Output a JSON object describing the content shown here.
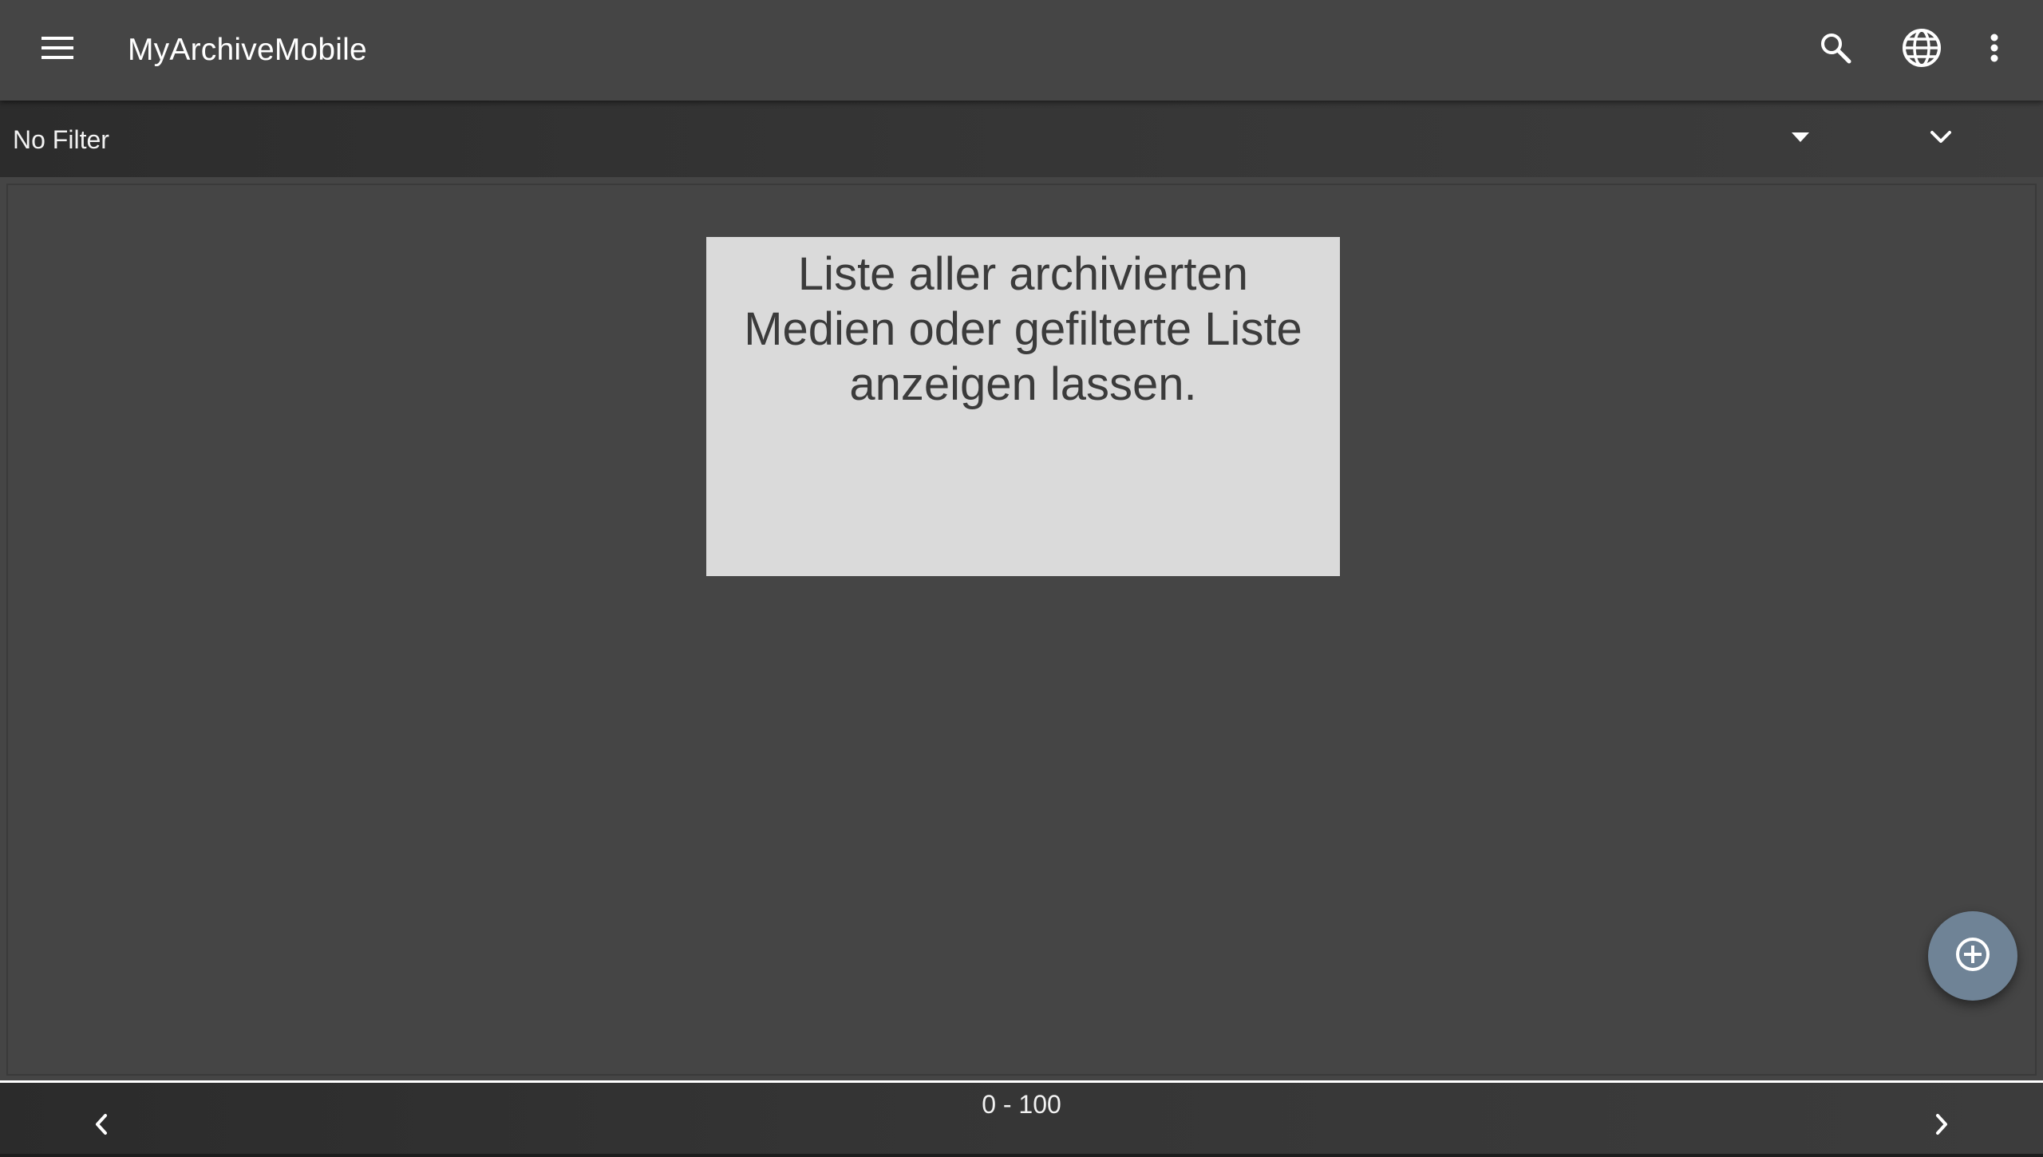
{
  "app": {
    "title": "MyArchiveMobile"
  },
  "appbar": {
    "menu_icon": "hamburger-menu-icon",
    "search_icon": "search-icon",
    "language_icon": "globe-icon",
    "overflow_icon": "more-vert-icon"
  },
  "filter": {
    "label": "No Filter",
    "dropdown_icon": "arrow-drop-down-icon",
    "expand_icon": "chevron-down-icon"
  },
  "content": {
    "info_text": "Liste aller archivierten Medien oder gefilterte Liste anzeigen lassen."
  },
  "fab": {
    "icon": "add-circle-icon"
  },
  "pagination": {
    "range": "0 - 100",
    "prev_icon": "chevron-left-icon",
    "next_icon": "chevron-right-icon"
  },
  "colors": {
    "background": "#454545",
    "card": "#dadada",
    "fab": "#6f8396",
    "text_light": "#ffffff",
    "text_dark": "#3b3b3b"
  }
}
